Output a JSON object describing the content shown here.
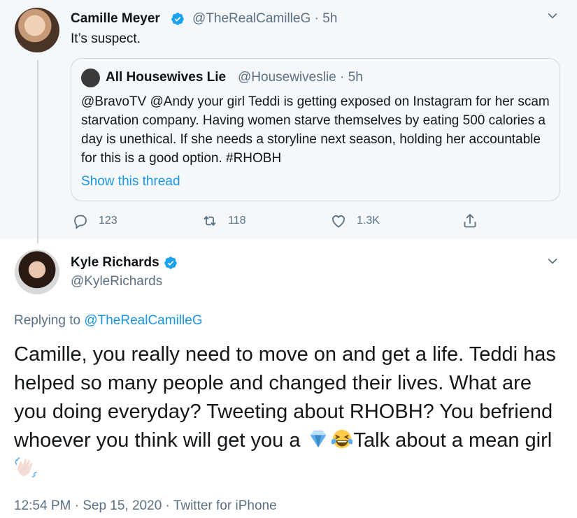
{
  "parent_tweet": {
    "author_name": "Camille Meyer",
    "handle": "@TheRealCamilleG",
    "separator": "·",
    "time": "5h",
    "text": "It’s suspect.",
    "quoted": {
      "author_name": "All Housewives Lie",
      "handle": "@Housewiveslie",
      "separator": "·",
      "time": "5h",
      "text": "@BravoTV @Andy your girl Teddi is getting exposed on Instagram for her scam starvation company. Having women starve themselves by eating 500 calories a day is unethical. If she needs a storyline next season, holding her accountable for this is a good option. #RHOBH",
      "show_thread_label": "Show this thread"
    },
    "actions": {
      "replies": "123",
      "retweets": "118",
      "likes": "1.3K"
    }
  },
  "main_tweet": {
    "author_name": "Kyle Richards",
    "handle": "@KyleRichards",
    "replying_prefix": "Replying to",
    "replying_to": "@TheRealCamilleG",
    "text_part1": "Camille, you really need to move on and get a life. Teddi has helped so many people and changed their lives. What are you doing everyday? Tweeting about RHOBH? You befriend whoever you think will get you a ",
    "text_part2": "Talk about a mean girl ",
    "emojis": [
      "gem-emoji",
      "tears-of-joy-emoji",
      "waving-hand-emoji"
    ],
    "timestamp": "12:54 PM · Sep 15, 2020 · Twitter for iPhone"
  },
  "colors": {
    "accent": "#1b95e0",
    "verified": "#1da1f2",
    "secondary_text": "#5b7083",
    "parent_background": "#f5f8fa",
    "border": "#ccd6dd"
  },
  "icons": [
    "verified-badge-icon",
    "chevron-down-icon",
    "reply-icon",
    "retweet-icon",
    "like-icon",
    "share-icon"
  ]
}
